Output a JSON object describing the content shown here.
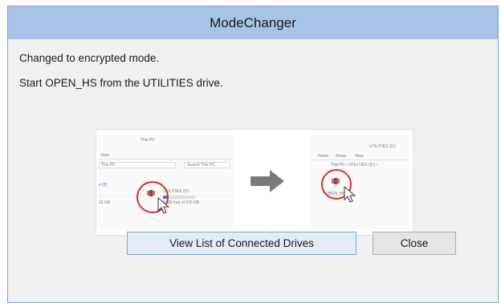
{
  "window": {
    "title": "ModeChanger"
  },
  "messages": {
    "line1": "Changed to encrypted mode.",
    "line2": "Start OPEN_HS from the UTILITIES drive."
  },
  "illustration": {
    "left": {
      "title": "This PC",
      "menu_view": "View",
      "address": "This PC",
      "search": "Search This PC",
      "section": "s (2)",
      "drive_label": "UTILITIES (D:)",
      "free_space": "8 GB free of 100 GB",
      "gb": "12 GB"
    },
    "right": {
      "title": "UTILITIES (D:)",
      "tab_share": "Share",
      "tab_view": "View",
      "tab_home": "Home",
      "breadcrumb": "This PC  ›  UTILITIES (D:)  ›",
      "file_label": "OPEN_HS"
    },
    "arrow_icon": "right-arrow-icon",
    "cursor_icon": "mouse-pointer-icon",
    "highlight_color": "#dd2c2c"
  },
  "buttons": {
    "drives": "View List of Connected Drives",
    "close": "Close"
  }
}
